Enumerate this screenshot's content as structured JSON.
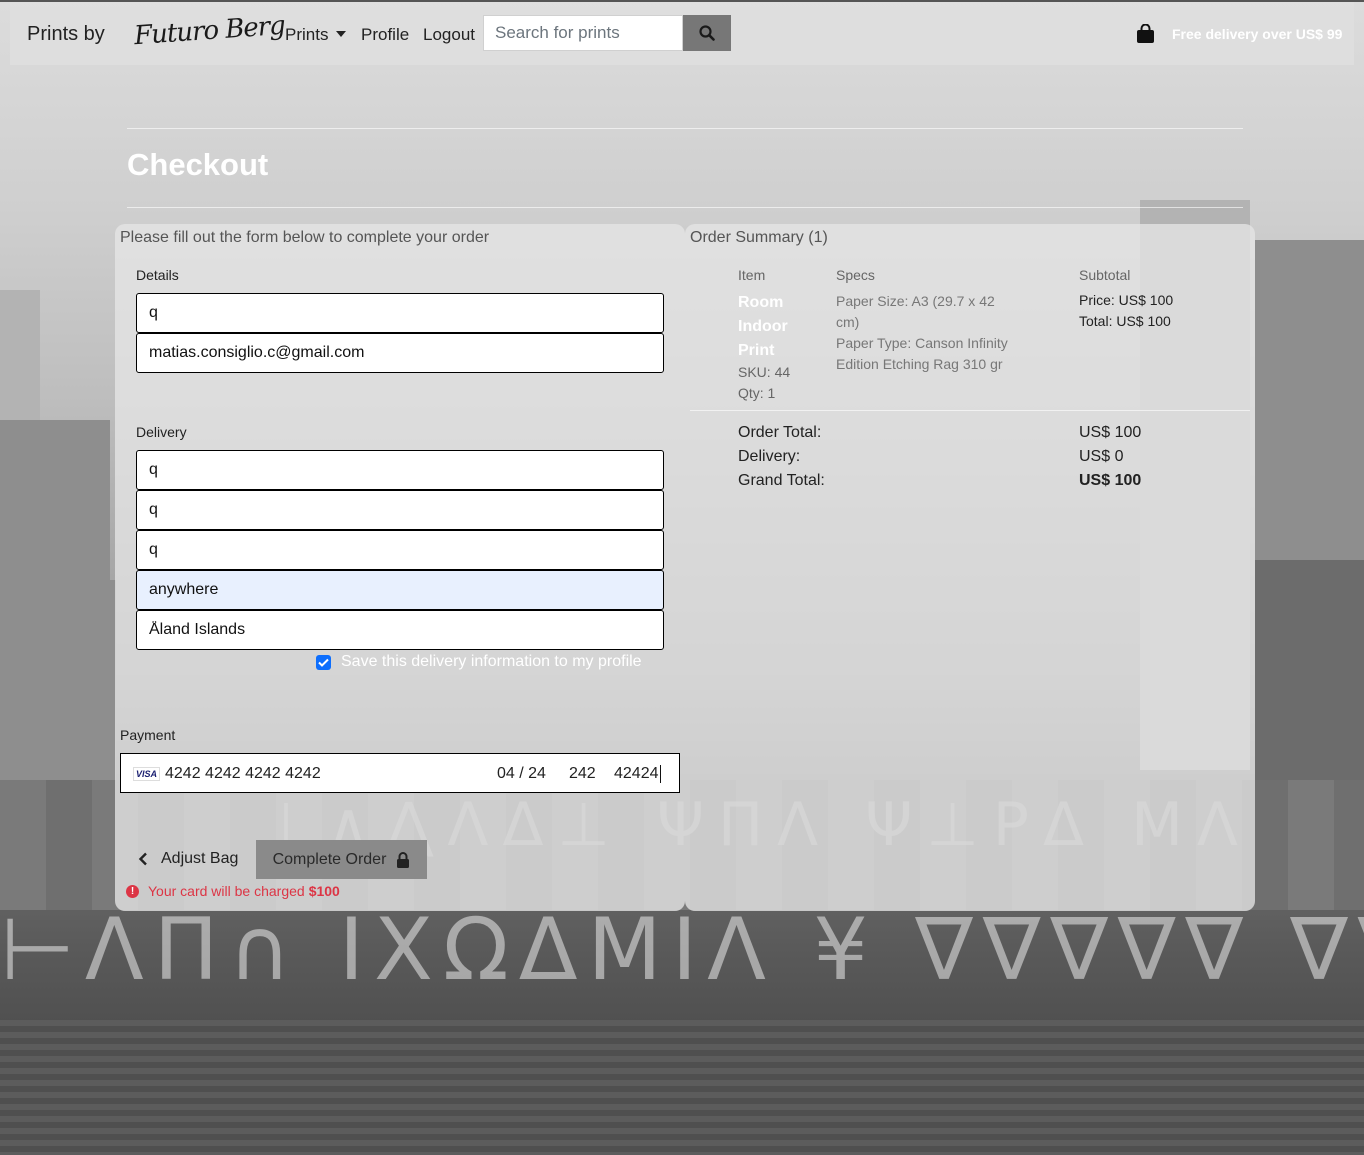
{
  "nav": {
    "brand": "Prints by",
    "logo_text": "Futuro Berg",
    "prints_label": "Prints",
    "profile_label": "Profile",
    "logout_label": "Logout",
    "search_placeholder": "Search for prints",
    "free_delivery": "Free delivery over US$ 99"
  },
  "page": {
    "title": "Checkout"
  },
  "form": {
    "intro": "Please fill out the form below to complete your order",
    "details_label": "Details",
    "details": [
      "q",
      "matias.consiglio.c@gmail.com"
    ],
    "delivery_label": "Delivery",
    "delivery": [
      "q",
      "q",
      "q",
      "anywhere",
      "Åland Islands"
    ],
    "save_info_label": "Save this delivery information to my profile",
    "payment_label": "Payment",
    "card": {
      "brand": "VISA",
      "number": "4242 4242 4242 4242",
      "expiry": "04 / 24",
      "cvc": "242",
      "zip": "42424"
    },
    "adjust_bag_label": "Adjust Bag",
    "complete_order_label": "Complete Order",
    "charge_text": "Your card will be charged",
    "charge_amount": "$100"
  },
  "summary": {
    "heading": "Order Summary (1)",
    "col_item": "Item",
    "col_specs": "Specs",
    "col_subtotal": "Subtotal",
    "item": {
      "name": "Room Indoor Print",
      "sku": "SKU: 44",
      "qty": "Qty: 1",
      "paper_size": "Paper Size: A3 (29.7 x 42 cm)",
      "paper_type": "Paper Type: Canson Infinity Edition Etching Rag 310 gr",
      "price": "Price: US$ 100",
      "total": "Total: US$ 100"
    },
    "order_total_label": "Order Total:",
    "order_total": "US$ 100",
    "delivery_label": "Delivery:",
    "delivery": "US$ 0",
    "grand_total_label": "Grand Total:",
    "grand_total": "US$ 100"
  },
  "colors": {
    "checkbox": "#0d6efd",
    "error": "#dc3545",
    "autofill": "#e8f0fe"
  }
}
